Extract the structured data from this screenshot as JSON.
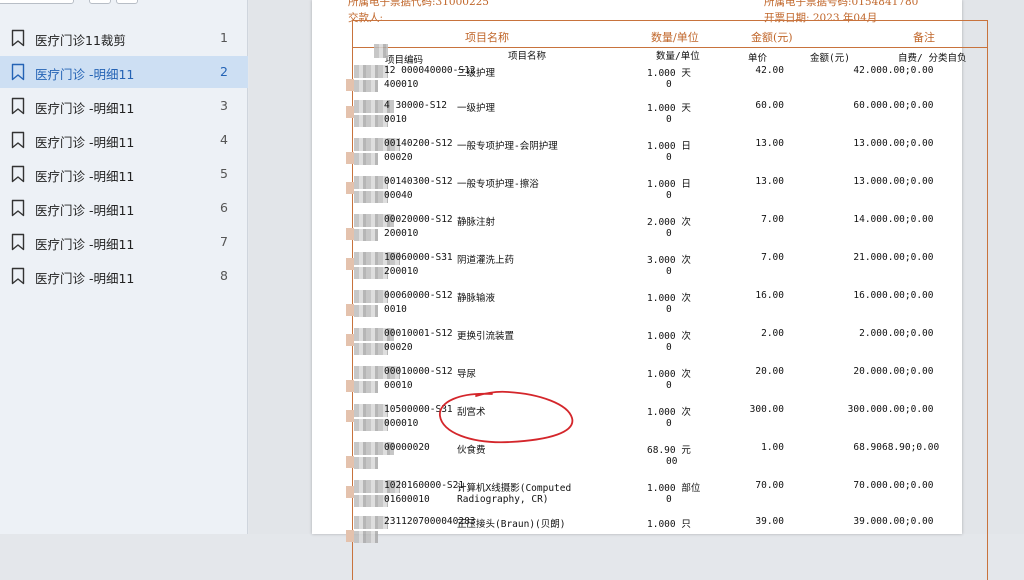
{
  "sidebar": {
    "items": [
      {
        "label": "医疗门诊11裁剪",
        "page": "1",
        "active": false
      },
      {
        "label": "医疗门诊 -明细11",
        "page": "2",
        "active": true
      },
      {
        "label": "医疗门诊 -明细11",
        "page": "3",
        "active": false
      },
      {
        "label": "医疗门诊 -明细11",
        "page": "4",
        "active": false
      },
      {
        "label": "医疗门诊 -明细11",
        "page": "5",
        "active": false
      },
      {
        "label": "医疗门诊 -明细11",
        "page": "6",
        "active": false
      },
      {
        "label": "医疗门诊 -明细11",
        "page": "7",
        "active": false
      },
      {
        "label": "医疗门诊 -明细11",
        "page": "8",
        "active": false
      }
    ]
  },
  "document": {
    "header": {
      "left_top": "所属电子票据代码:31000225",
      "right_top": "所属电子票据号码:0154841780",
      "payer_label": "交款人:",
      "issue_date": "开票日期: 2023 年04月"
    },
    "columns": [
      "项目名称",
      "数量/单位",
      "金额(元)",
      "备注"
    ],
    "sub_headers": {
      "code": "项目编码",
      "name": "项目名称",
      "qty": "数量/单位",
      "price": "单价",
      "amount": "金额(元)",
      "self": "自费/ 分类自负"
    },
    "rows": [
      {
        "code1": "12 000040000-S12",
        "code2": "400010",
        "name": "二级护理",
        "qty": "1.000 天",
        "qty2": "0",
        "price": "42.00",
        "amount": "42.00",
        "self": "0.00;0.00"
      },
      {
        "code1": "4 30000-S12",
        "code2": "0010",
        "name": "一级护理",
        "qty": "1.000 天",
        "qty2": "0",
        "price": "60.00",
        "amount": "60.00",
        "self": "0.00;0.00"
      },
      {
        "code1": "00140200-S12",
        "code2": "00020",
        "name": "一般专项护理-会阴护理",
        "qty": "1.000 日",
        "qty2": "0",
        "price": "13.00",
        "amount": "13.00",
        "self": "0.00;0.00"
      },
      {
        "code1": "00140300-S12",
        "code2": "00040",
        "name": "一般专项护理-擦浴",
        "qty": "1.000 日",
        "qty2": "0",
        "price": "13.00",
        "amount": "13.00",
        "self": "0.00;0.00"
      },
      {
        "code1": "00020000-S12",
        "code2": "200010",
        "name": "静脉注射",
        "qty": "2.000 次",
        "qty2": "0",
        "price": "7.00",
        "amount": "14.00",
        "self": "0.00;0.00"
      },
      {
        "code1": "10060000-S31",
        "code2": "200010",
        "name": "阴道灌洗上药",
        "qty": "3.000 次",
        "qty2": "0",
        "price": "7.00",
        "amount": "21.00",
        "self": "0.00;0.00"
      },
      {
        "code1": "00060000-S12",
        "code2": "0010",
        "name": "静脉输液",
        "qty": "1.000 次",
        "qty2": "0",
        "price": "16.00",
        "amount": "16.00",
        "self": "0.00;0.00"
      },
      {
        "code1": "00010001-S12",
        "code2": "00020",
        "name": "更换引流装置",
        "qty": "1.000 次",
        "qty2": "0",
        "price": "2.00",
        "amount": "2.00",
        "self": "0.00;0.00"
      },
      {
        "code1": "00010000-S12",
        "code2": "00010",
        "name": "导尿",
        "qty": "1.000 次",
        "qty2": "0",
        "price": "20.00",
        "amount": "20.00",
        "self": "0.00;0.00"
      },
      {
        "code1": "10500000-S31",
        "code2": "000010",
        "name": "刮宫术",
        "qty": "1.000 次",
        "qty2": "0",
        "price": "300.00",
        "amount": "300.00",
        "self": "0.00;0.00"
      },
      {
        "code1": "00000020",
        "code2": "",
        "name": "伙食费",
        "qty": "68.90 元",
        "qty2": "00",
        "price": "1.00",
        "amount": "68.90",
        "self": "68.90;0.00"
      },
      {
        "code1": "1020160000-S21",
        "code2": "01600010",
        "name": "计算机X线摄影(Computed",
        "name2": "Radiography, CR)",
        "qty": "1.000 部位",
        "qty2": "0",
        "price": "70.00",
        "amount": "70.00",
        "self": "0.00;0.00"
      },
      {
        "code1": "2311207000040283",
        "code2": "",
        "name": "正压接头(Braun)(贝朗)",
        "qty": "1.000 只",
        "qty2": "",
        "price": "39.00",
        "amount": "39.00",
        "self": "0.00;0.00"
      }
    ]
  }
}
